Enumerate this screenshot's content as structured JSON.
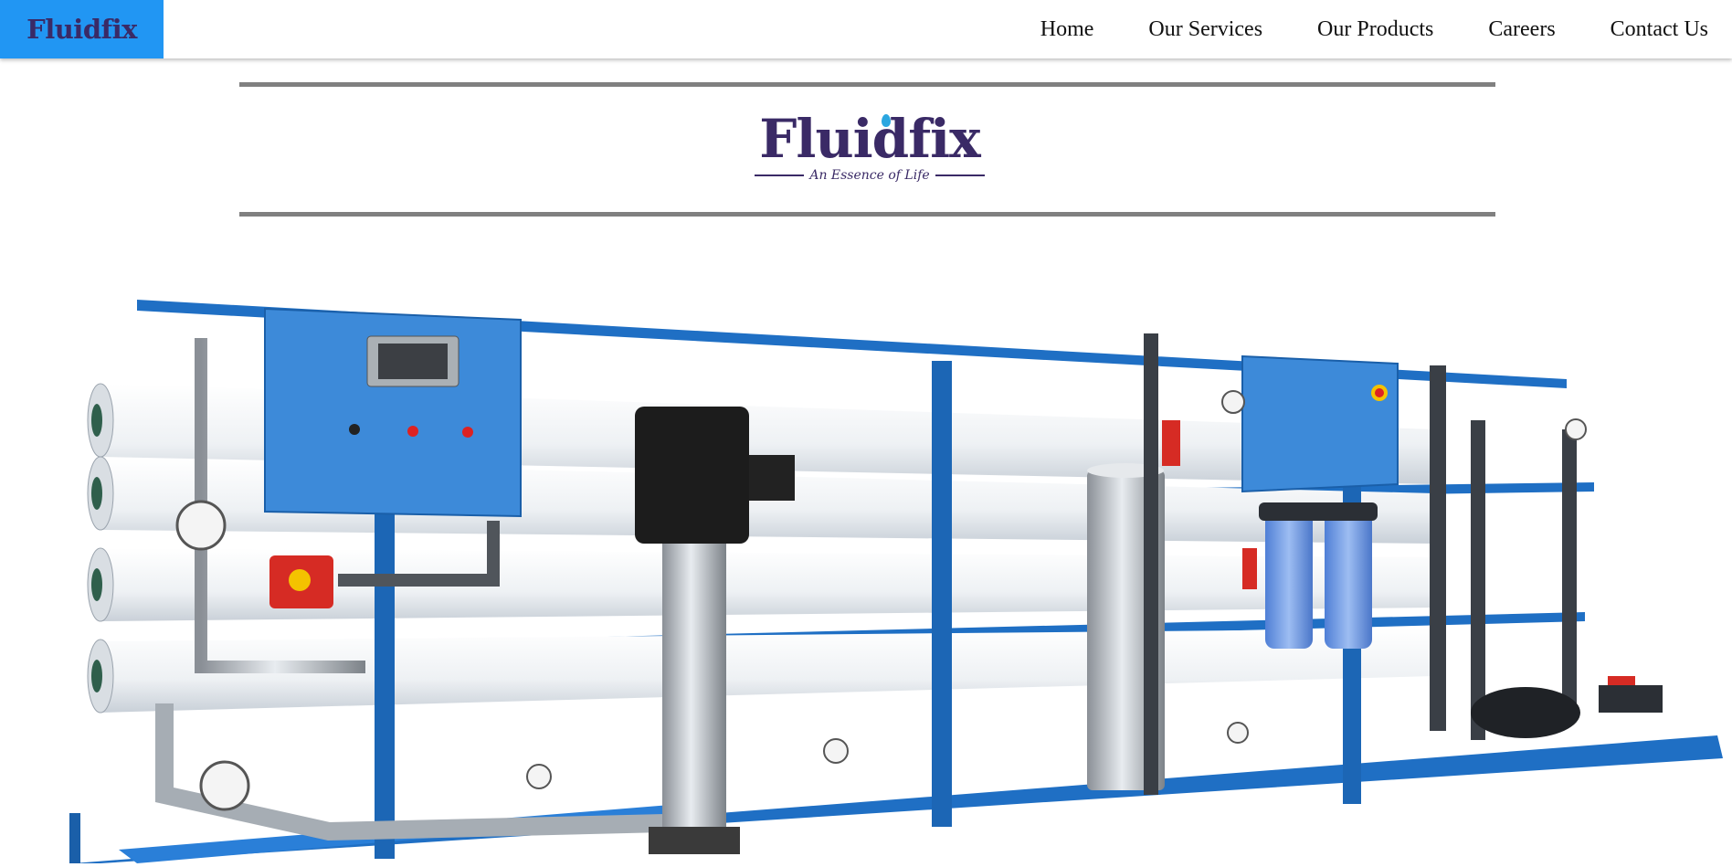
{
  "header": {
    "brand": "Fluidfix",
    "nav": [
      "Home",
      "Our Services",
      "Our Products",
      "Careers",
      "Contact Us"
    ]
  },
  "logo": {
    "name": "Fluidfix",
    "tagline": "An Essence of Life"
  },
  "colors": {
    "brand_bg": "#2196f3",
    "logo_text": "#3a2a66",
    "rule": "#808080",
    "frame_blue": "#1f6fc4",
    "membrane_white": "#f2f4f6"
  }
}
